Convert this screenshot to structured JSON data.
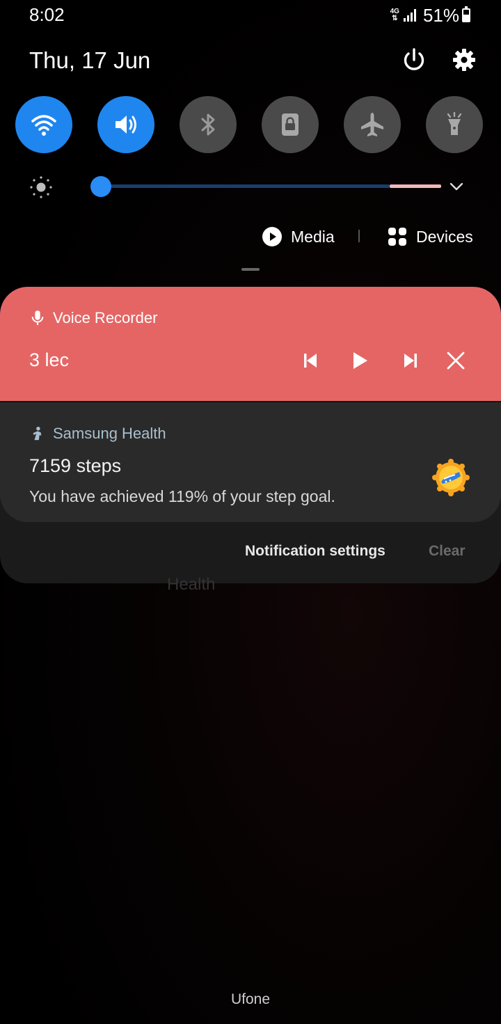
{
  "status_bar": {
    "time": "8:02",
    "network_type": "4G",
    "battery_percent": "51%",
    "battery_level": 0.51
  },
  "header": {
    "date": "Thu, 17 Jun",
    "icons": [
      "power-icon",
      "gear-icon"
    ]
  },
  "quick_toggles": [
    {
      "name": "wifi",
      "icon": "wifi-icon",
      "active": true
    },
    {
      "name": "sound",
      "icon": "volume-icon",
      "active": true
    },
    {
      "name": "bluetooth",
      "icon": "bluetooth-icon",
      "active": false
    },
    {
      "name": "screen-lock",
      "icon": "lock-icon",
      "active": false
    },
    {
      "name": "airplane-mode",
      "icon": "airplane-icon",
      "active": false
    },
    {
      "name": "flashlight",
      "icon": "flashlight-icon",
      "active": false
    }
  ],
  "brightness": {
    "level": 0.02
  },
  "media_row": {
    "media_label": "Media",
    "devices_label": "Devices"
  },
  "notifications": {
    "voice_recorder": {
      "app_name": "Voice Recorder",
      "title": "3 lec",
      "color": "#e56565"
    },
    "samsung_health": {
      "app_name": "Samsung Health",
      "title": "7159 steps",
      "text": "You have achieved 119% of your step goal."
    },
    "settings_label": "Notification settings",
    "clear_label": "Clear"
  },
  "background": {
    "partial_text": "Health"
  },
  "carrier": "Ufone",
  "colors": {
    "accent": "#1f86f0",
    "voice_card": "#e56565",
    "health_card": "#2a2a2a"
  }
}
